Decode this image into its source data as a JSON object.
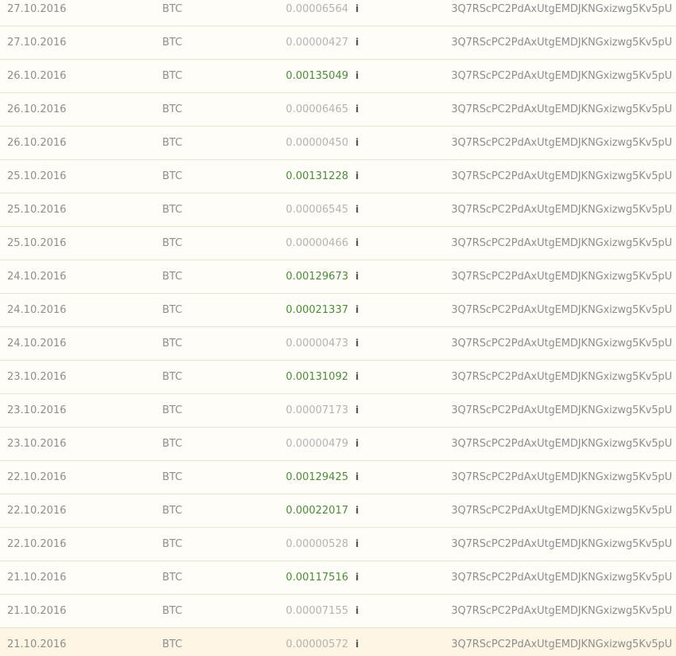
{
  "transactions": [
    {
      "date": "27.10.2016",
      "currency": "BTC",
      "amount": "0.00006564",
      "type": "fee",
      "address": "3Q7RScPC2PdAxUtgEMDJKNGxizwg5Kv5pU"
    },
    {
      "date": "27.10.2016",
      "currency": "BTC",
      "amount": "0.00000427",
      "type": "fee",
      "address": "3Q7RScPC2PdAxUtgEMDJKNGxizwg5Kv5pU"
    },
    {
      "date": "26.10.2016",
      "currency": "BTC",
      "amount": "0.00135049",
      "type": "payout",
      "address": "3Q7RScPC2PdAxUtgEMDJKNGxizwg5Kv5pU"
    },
    {
      "date": "26.10.2016",
      "currency": "BTC",
      "amount": "0.00006465",
      "type": "fee",
      "address": "3Q7RScPC2PdAxUtgEMDJKNGxizwg5Kv5pU"
    },
    {
      "date": "26.10.2016",
      "currency": "BTC",
      "amount": "0.00000450",
      "type": "fee",
      "address": "3Q7RScPC2PdAxUtgEMDJKNGxizwg5Kv5pU"
    },
    {
      "date": "25.10.2016",
      "currency": "BTC",
      "amount": "0.00131228",
      "type": "payout",
      "address": "3Q7RScPC2PdAxUtgEMDJKNGxizwg5Kv5pU"
    },
    {
      "date": "25.10.2016",
      "currency": "BTC",
      "amount": "0.00006545",
      "type": "fee",
      "address": "3Q7RScPC2PdAxUtgEMDJKNGxizwg5Kv5pU"
    },
    {
      "date": "25.10.2016",
      "currency": "BTC",
      "amount": "0.00000466",
      "type": "fee",
      "address": "3Q7RScPC2PdAxUtgEMDJKNGxizwg5Kv5pU"
    },
    {
      "date": "24.10.2016",
      "currency": "BTC",
      "amount": "0.00129673",
      "type": "payout",
      "address": "3Q7RScPC2PdAxUtgEMDJKNGxizwg5Kv5pU"
    },
    {
      "date": "24.10.2016",
      "currency": "BTC",
      "amount": "0.00021337",
      "type": "payout",
      "address": "3Q7RScPC2PdAxUtgEMDJKNGxizwg5Kv5pU"
    },
    {
      "date": "24.10.2016",
      "currency": "BTC",
      "amount": "0.00000473",
      "type": "fee",
      "address": "3Q7RScPC2PdAxUtgEMDJKNGxizwg5Kv5pU"
    },
    {
      "date": "23.10.2016",
      "currency": "BTC",
      "amount": "0.00131092",
      "type": "payout",
      "address": "3Q7RScPC2PdAxUtgEMDJKNGxizwg5Kv5pU"
    },
    {
      "date": "23.10.2016",
      "currency": "BTC",
      "amount": "0.00007173",
      "type": "fee",
      "address": "3Q7RScPC2PdAxUtgEMDJKNGxizwg5Kv5pU"
    },
    {
      "date": "23.10.2016",
      "currency": "BTC",
      "amount": "0.00000479",
      "type": "fee",
      "address": "3Q7RScPC2PdAxUtgEMDJKNGxizwg5Kv5pU"
    },
    {
      "date": "22.10.2016",
      "currency": "BTC",
      "amount": "0.00129425",
      "type": "payout",
      "address": "3Q7RScPC2PdAxUtgEMDJKNGxizwg5Kv5pU"
    },
    {
      "date": "22.10.2016",
      "currency": "BTC",
      "amount": "0.00022017",
      "type": "payout",
      "address": "3Q7RScPC2PdAxUtgEMDJKNGxizwg5Kv5pU"
    },
    {
      "date": "22.10.2016",
      "currency": "BTC",
      "amount": "0.00000528",
      "type": "fee",
      "address": "3Q7RScPC2PdAxUtgEMDJKNGxizwg5Kv5pU"
    },
    {
      "date": "21.10.2016",
      "currency": "BTC",
      "amount": "0.00117516",
      "type": "payout",
      "address": "3Q7RScPC2PdAxUtgEMDJKNGxizwg5Kv5pU"
    },
    {
      "date": "21.10.2016",
      "currency": "BTC",
      "amount": "0.00007155",
      "type": "fee",
      "address": "3Q7RScPC2PdAxUtgEMDJKNGxizwg5Kv5pU"
    },
    {
      "date": "21.10.2016",
      "currency": "BTC",
      "amount": "0.00000572",
      "type": "fee",
      "highlighted": true,
      "address": "3Q7RScPC2PdAxUtgEMDJKNGxizwg5Kv5pU"
    }
  ],
  "info_icon_glyph": "i",
  "colors": {
    "payout_amount": "#4f8a3c",
    "fee_amount": "#b3b3b3",
    "row_background": "#fefdf8",
    "row_highlight": "#fdf5e4",
    "row_border": "#e8e3d3"
  }
}
